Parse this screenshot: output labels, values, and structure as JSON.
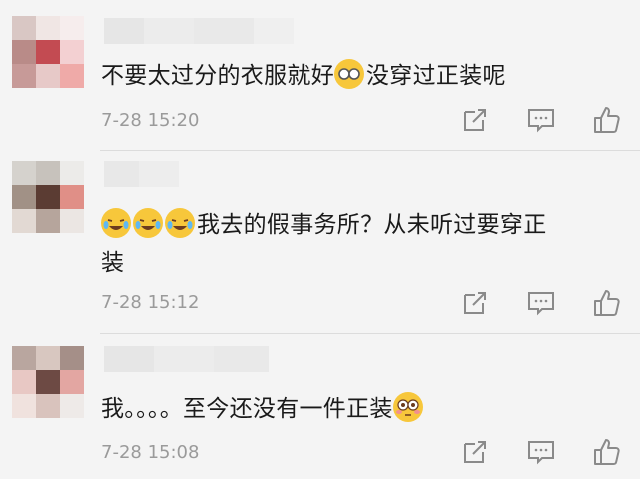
{
  "comments": [
    {
      "text_before": "不要太过分的衣服就好",
      "emojis_mid": [
        "glasses-face-icon"
      ],
      "text_after": "没穿过正装呢",
      "time": "7-28 15:20"
    },
    {
      "emojis_lead": [
        "laugh-cry-icon",
        "laugh-cry-icon",
        "laugh-cry-icon"
      ],
      "text_line1": "我去的假事务所？从未听过要穿正",
      "text_line2": "装",
      "time": "7-28 15:12"
    },
    {
      "text_before": "我。。。。至今还没有一件正装",
      "emojis_end": [
        "flushed-face-icon"
      ],
      "time": "7-28 15:08"
    }
  ],
  "actions": [
    "share-icon",
    "comment-icon",
    "like-icon"
  ],
  "colors": {
    "background": "#f4f4f4",
    "text": "#1a1a1a",
    "meta": "#9a9a9a",
    "icon": "#8a8a8a",
    "emoji_yellow": "#f7c73b"
  }
}
